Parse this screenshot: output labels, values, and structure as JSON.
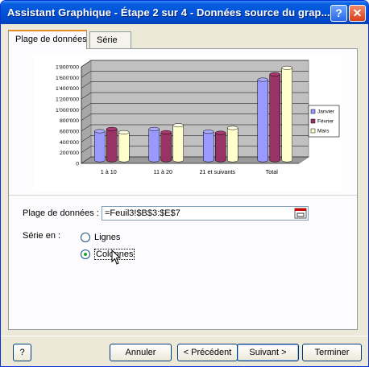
{
  "window": {
    "title": "Assistant Graphique - Étape 2 sur 4 - Données source du grap...",
    "help_glyph": "?",
    "close_glyph": "✕"
  },
  "tabs": [
    {
      "label": "Plage de données",
      "active": true
    },
    {
      "label": "Série",
      "active": false
    }
  ],
  "chart_data": {
    "type": "bar",
    "categories": [
      "1 à 10",
      "11 à 20",
      "21 et suivants",
      "Total"
    ],
    "series": [
      {
        "name": "Janvier",
        "values": [
          540000,
          580000,
          530000,
          1500000
        ],
        "color": "#9999ff"
      },
      {
        "name": "Février",
        "values": [
          580000,
          520000,
          510000,
          1600000
        ],
        "color": "#993366"
      },
      {
        "name": "Mars",
        "values": [
          520000,
          650000,
          600000,
          1720000
        ],
        "color": "#ffffcc"
      }
    ],
    "y_ticks": [
      "0",
      "200'000",
      "400'000",
      "600'000",
      "800'000",
      "1'000'000",
      "1'200'000",
      "1'400'000",
      "1'600'000",
      "1'800'000"
    ],
    "ylim": [
      0,
      1800000
    ],
    "legend_labels": [
      "Janvier",
      "Février",
      "Mars"
    ],
    "legend_position": "right",
    "grid": true,
    "style": "3d-cylinder",
    "wall_color": "#c0c0c0"
  },
  "form": {
    "range_label": "Plage de données :",
    "range_value": "=Feuil3!$B$3:$E$7",
    "series_label": "Série en :",
    "option_rows": "Lignes",
    "option_columns": "Colonnes",
    "selected": "Colonnes"
  },
  "buttons": {
    "help": "?",
    "cancel": "Annuler",
    "back": "< Précédent",
    "next": "Suivant >",
    "finish": "Terminer"
  }
}
